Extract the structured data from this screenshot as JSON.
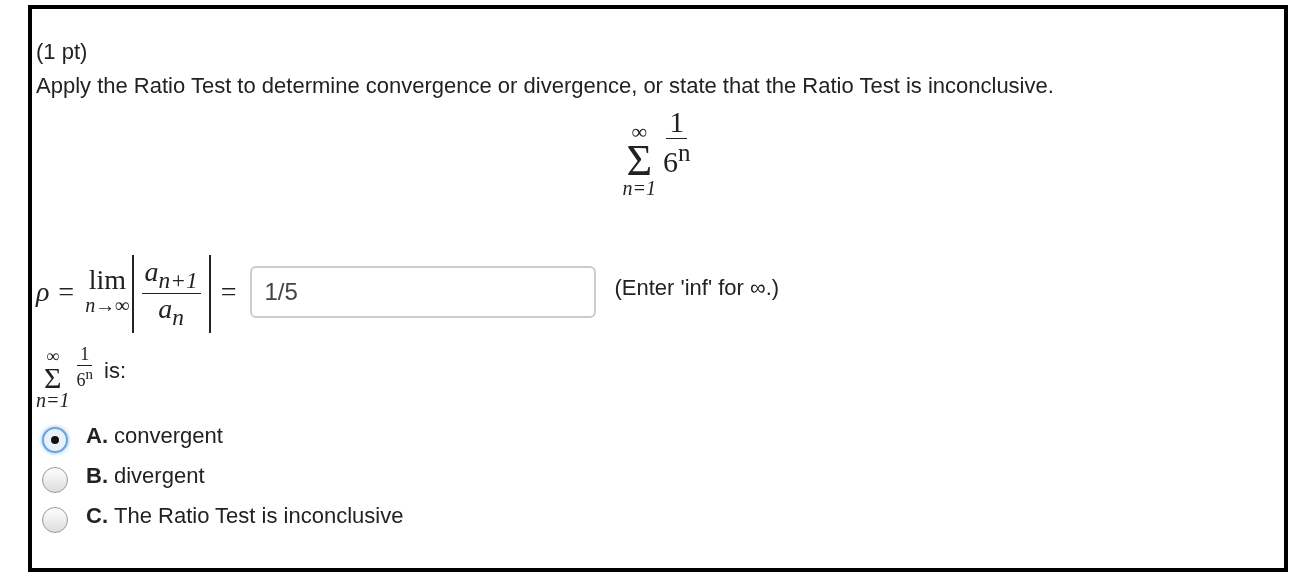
{
  "points": "(1 pt)",
  "instruction": "Apply the Ratio Test to determine convergence or divergence, or state that the Ratio Test is inconclusive.",
  "series": {
    "upper": "∞",
    "symbol": "Σ",
    "lower": "n=1",
    "numerator": "1",
    "denominator": "6$^{n}$"
  },
  "ratio": {
    "lhs": "ρ =",
    "lim": "lim",
    "lim_sub": "n→∞",
    "numerator": "a$_{n+1}$",
    "denominator": "a$_{n}$",
    "equals": "=",
    "answer": {
      "value": "1/5"
    },
    "hint": "(Enter 'inf' for ∞.)"
  },
  "question": {
    "upper": "∞",
    "symbol": "Σ",
    "lower": "n=1",
    "numerator": "1",
    "denominator": "6$^{n}$",
    "suffix": "is:"
  },
  "options": [
    {
      "letter": "A.",
      "text": "convergent",
      "selected": true
    },
    {
      "letter": "B.",
      "text": "divergent",
      "selected": false
    },
    {
      "letter": "C.",
      "text": "The Ratio Test is inconclusive",
      "selected": false
    }
  ]
}
